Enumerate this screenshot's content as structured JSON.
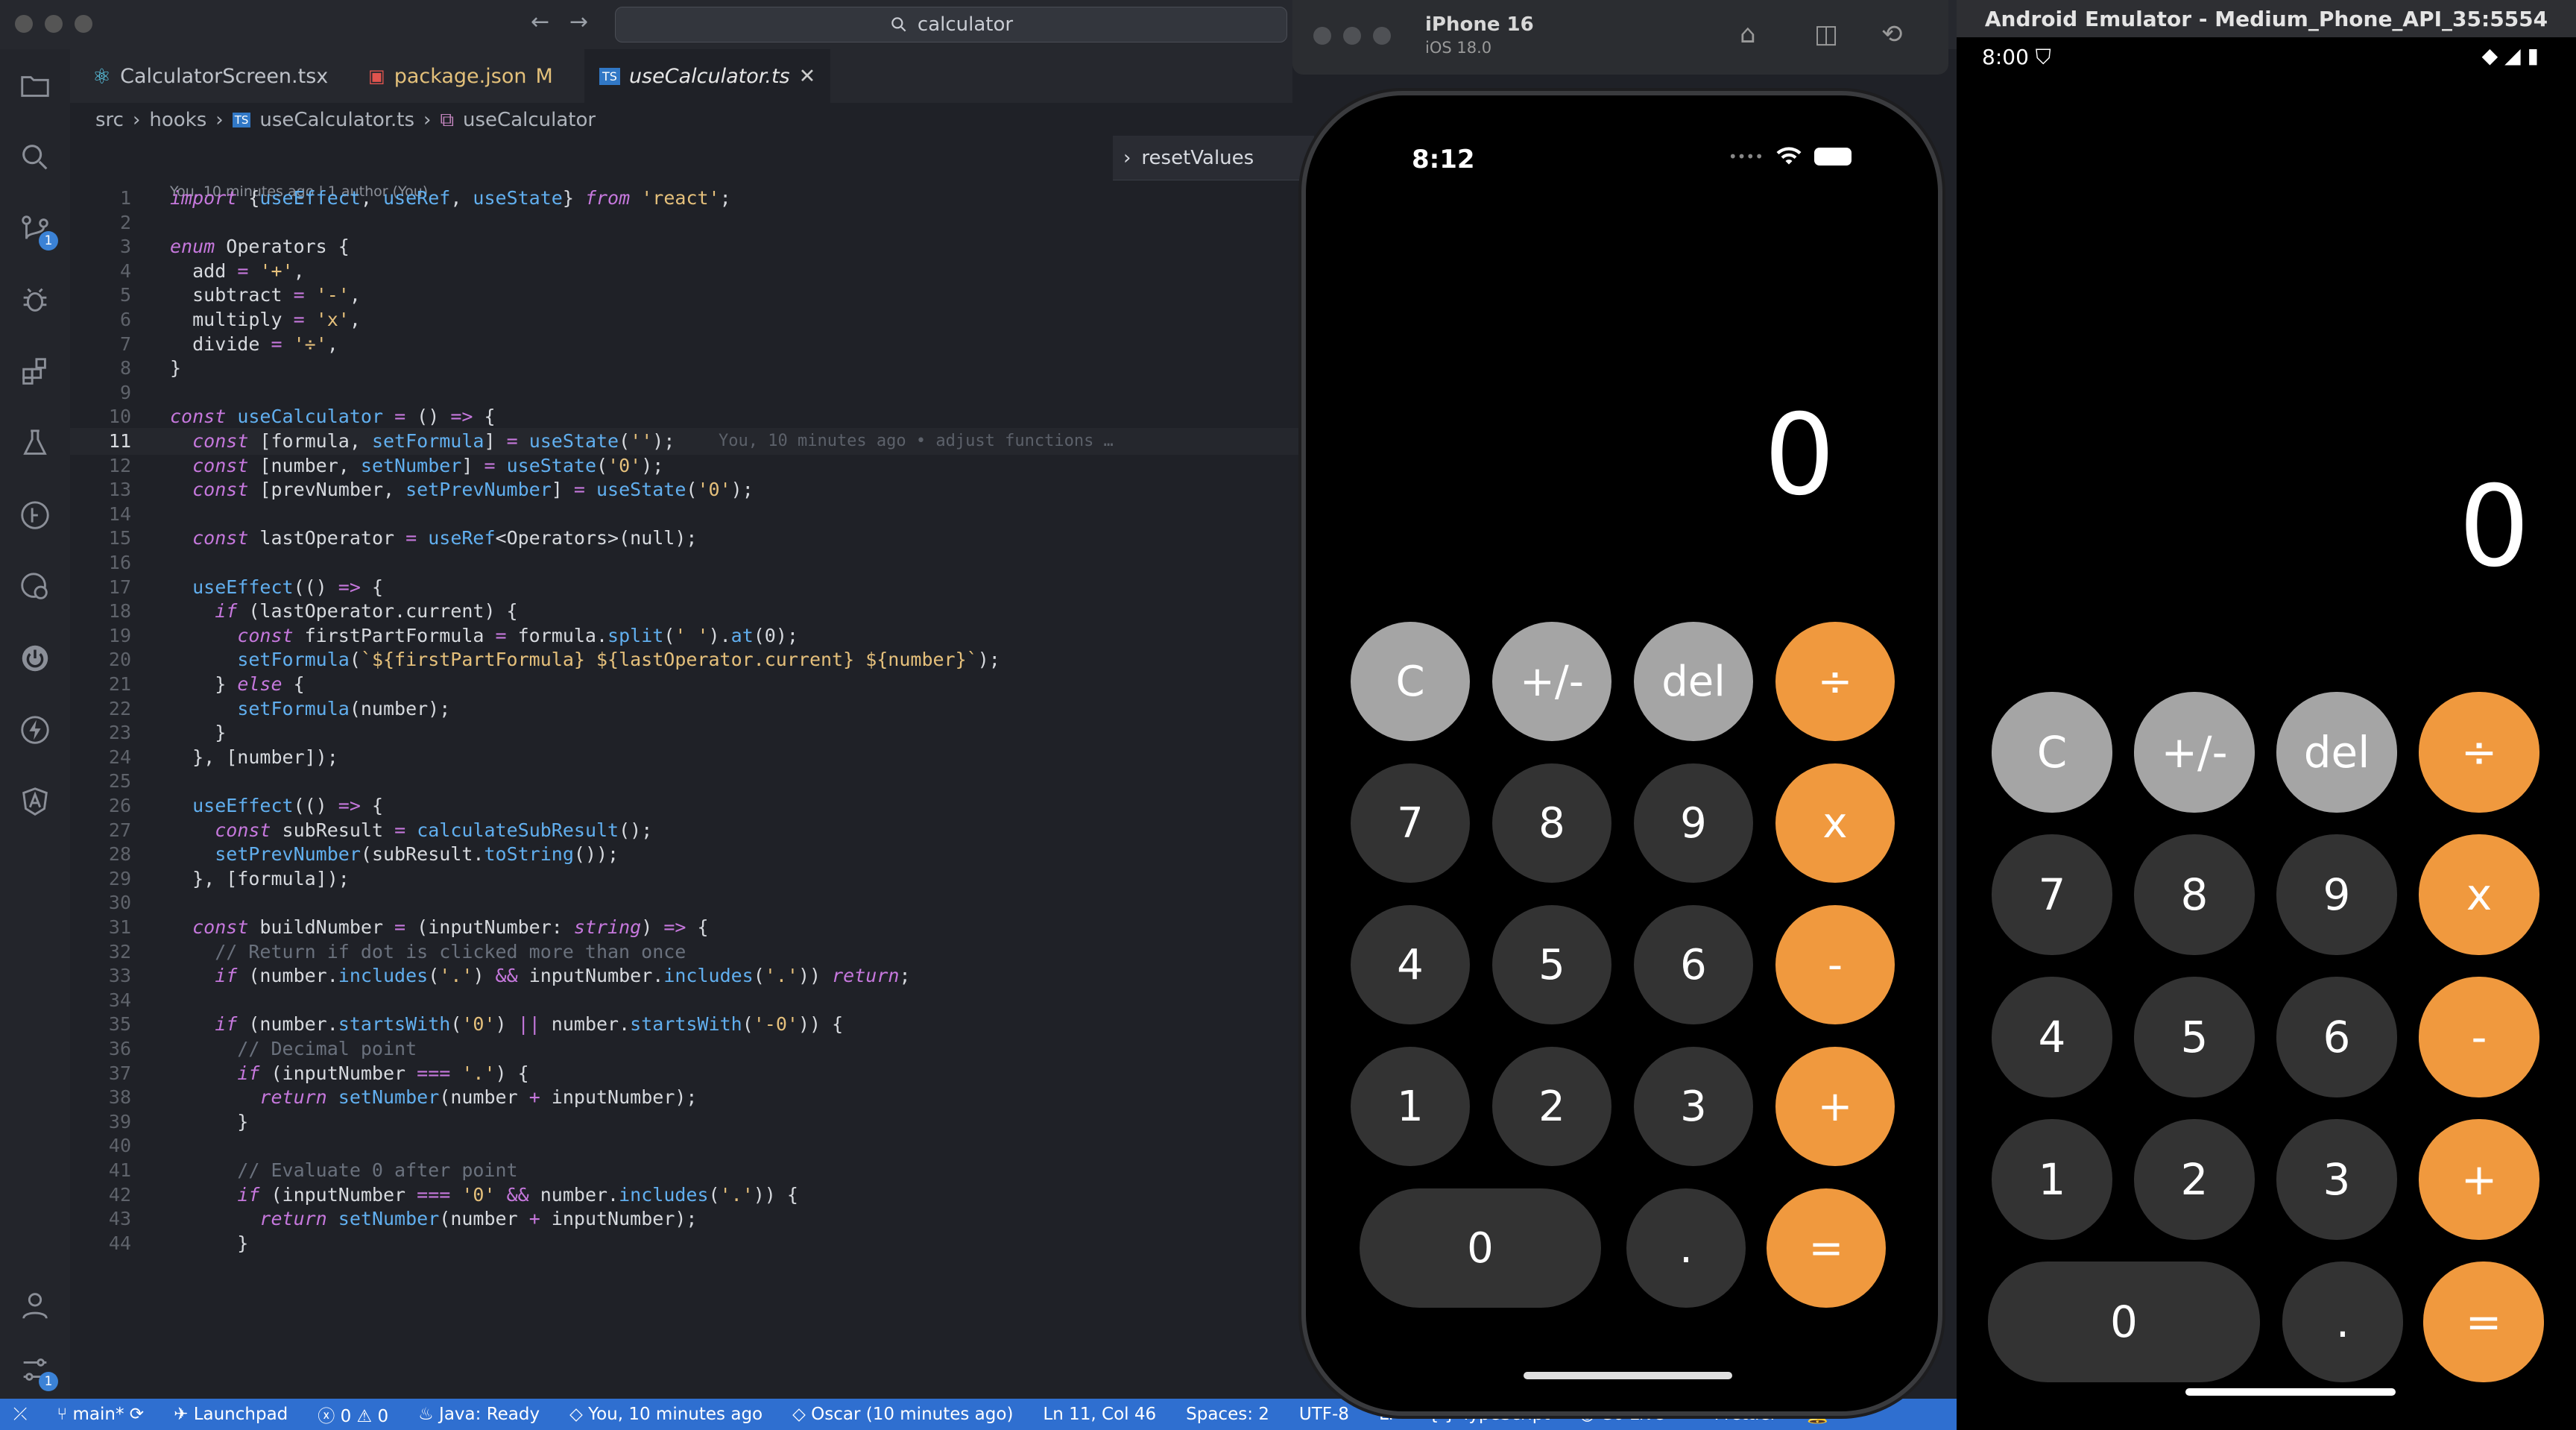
{
  "vscode": {
    "search_text": "calculator",
    "tabs": [
      {
        "label": "CalculatorScreen.tsx",
        "icon": "react-icon"
      },
      {
        "label": "package.json",
        "modified": "M",
        "icon": "json-icon"
      },
      {
        "label": "useCalculator.ts",
        "icon": "ts-icon"
      }
    ],
    "breadcrumb": [
      "src",
      "hooks",
      "useCalculator.ts",
      "useCalculator"
    ],
    "sticky_scroll": "resetValues",
    "blame_header": "You, 10 minutes ago | 1 author (You)",
    "inline_blame": "You, 10 minutes ago • adjust functions …",
    "current_line": 11,
    "lines": [
      "import {useEffect, useRef, useState} from 'react';",
      "",
      "enum Operators {",
      "  add = '+',",
      "  subtract = '-',",
      "  multiply = 'x',",
      "  divide = '÷',",
      "}",
      "",
      "const useCalculator = () => {",
      "  const [formula, setFormula] = useState('');",
      "  const [number, setNumber] = useState('0');",
      "  const [prevNumber, setPrevNumber] = useState('0');",
      "",
      "  const lastOperator = useRef<Operators>(null);",
      "",
      "  useEffect(() => {",
      "    if (lastOperator.current) {",
      "      const firstPartFormula = formula.split(' ').at(0);",
      "      setFormula(`${firstPartFormula} ${lastOperator.current} ${number}`);",
      "    } else {",
      "      setFormula(number);",
      "    }",
      "  }, [number]);",
      "",
      "  useEffect(() => {",
      "    const subResult = calculateSubResult();",
      "    setPrevNumber(subResult.toString());",
      "  }, [formula]);",
      "",
      "  const buildNumber = (inputNumber: string) => {",
      "    // Return if dot is clicked more than once",
      "    if (number.includes('.') && inputNumber.includes('.')) return;",
      "",
      "    if (number.startsWith('0') || number.startsWith('-0')) {",
      "      // Decimal point",
      "      if (inputNumber === '.') {",
      "        return setNumber(number + inputNumber);",
      "      }",
      "",
      "      // Evaluate 0 after point",
      "      if (inputNumber === '0' && number.includes('.')) {",
      "        return setNumber(number + inputNumber);",
      "      }"
    ],
    "status": {
      "branch": "main*",
      "launchpad": "Launchpad",
      "problems": "0 ⚠ 0",
      "java": "Java: Ready",
      "blame": "You, 10 minutes ago",
      "author": "Oscar (10 minutes ago)",
      "cursor": "Ln 11, Col 46",
      "spaces": "Spaces: 2",
      "encoding": "UTF-8",
      "eol": "LF",
      "language": "TypeScript",
      "golive": "Go Live",
      "prettier": "Prettier"
    }
  },
  "ios_sim": {
    "device": "iPhone 16",
    "os": "iOS 18.0",
    "time": "8:12",
    "display": "0"
  },
  "android": {
    "title": "Android Emulator - Medium_Phone_API_35:5554",
    "time": "8:00",
    "display": "0"
  },
  "keypad": {
    "row1": [
      "C",
      "+/-",
      "del",
      "÷"
    ],
    "row2": [
      "7",
      "8",
      "9",
      "x"
    ],
    "row3": [
      "4",
      "5",
      "6",
      "-"
    ],
    "row4": [
      "1",
      "2",
      "3",
      "+"
    ],
    "row5": [
      "0",
      ".",
      "="
    ]
  },
  "colors": {
    "key_light": "#a5a5a5",
    "key_dark": "#333333",
    "key_orange": "#f0993e",
    "statusbar": "#2f6fd0"
  }
}
